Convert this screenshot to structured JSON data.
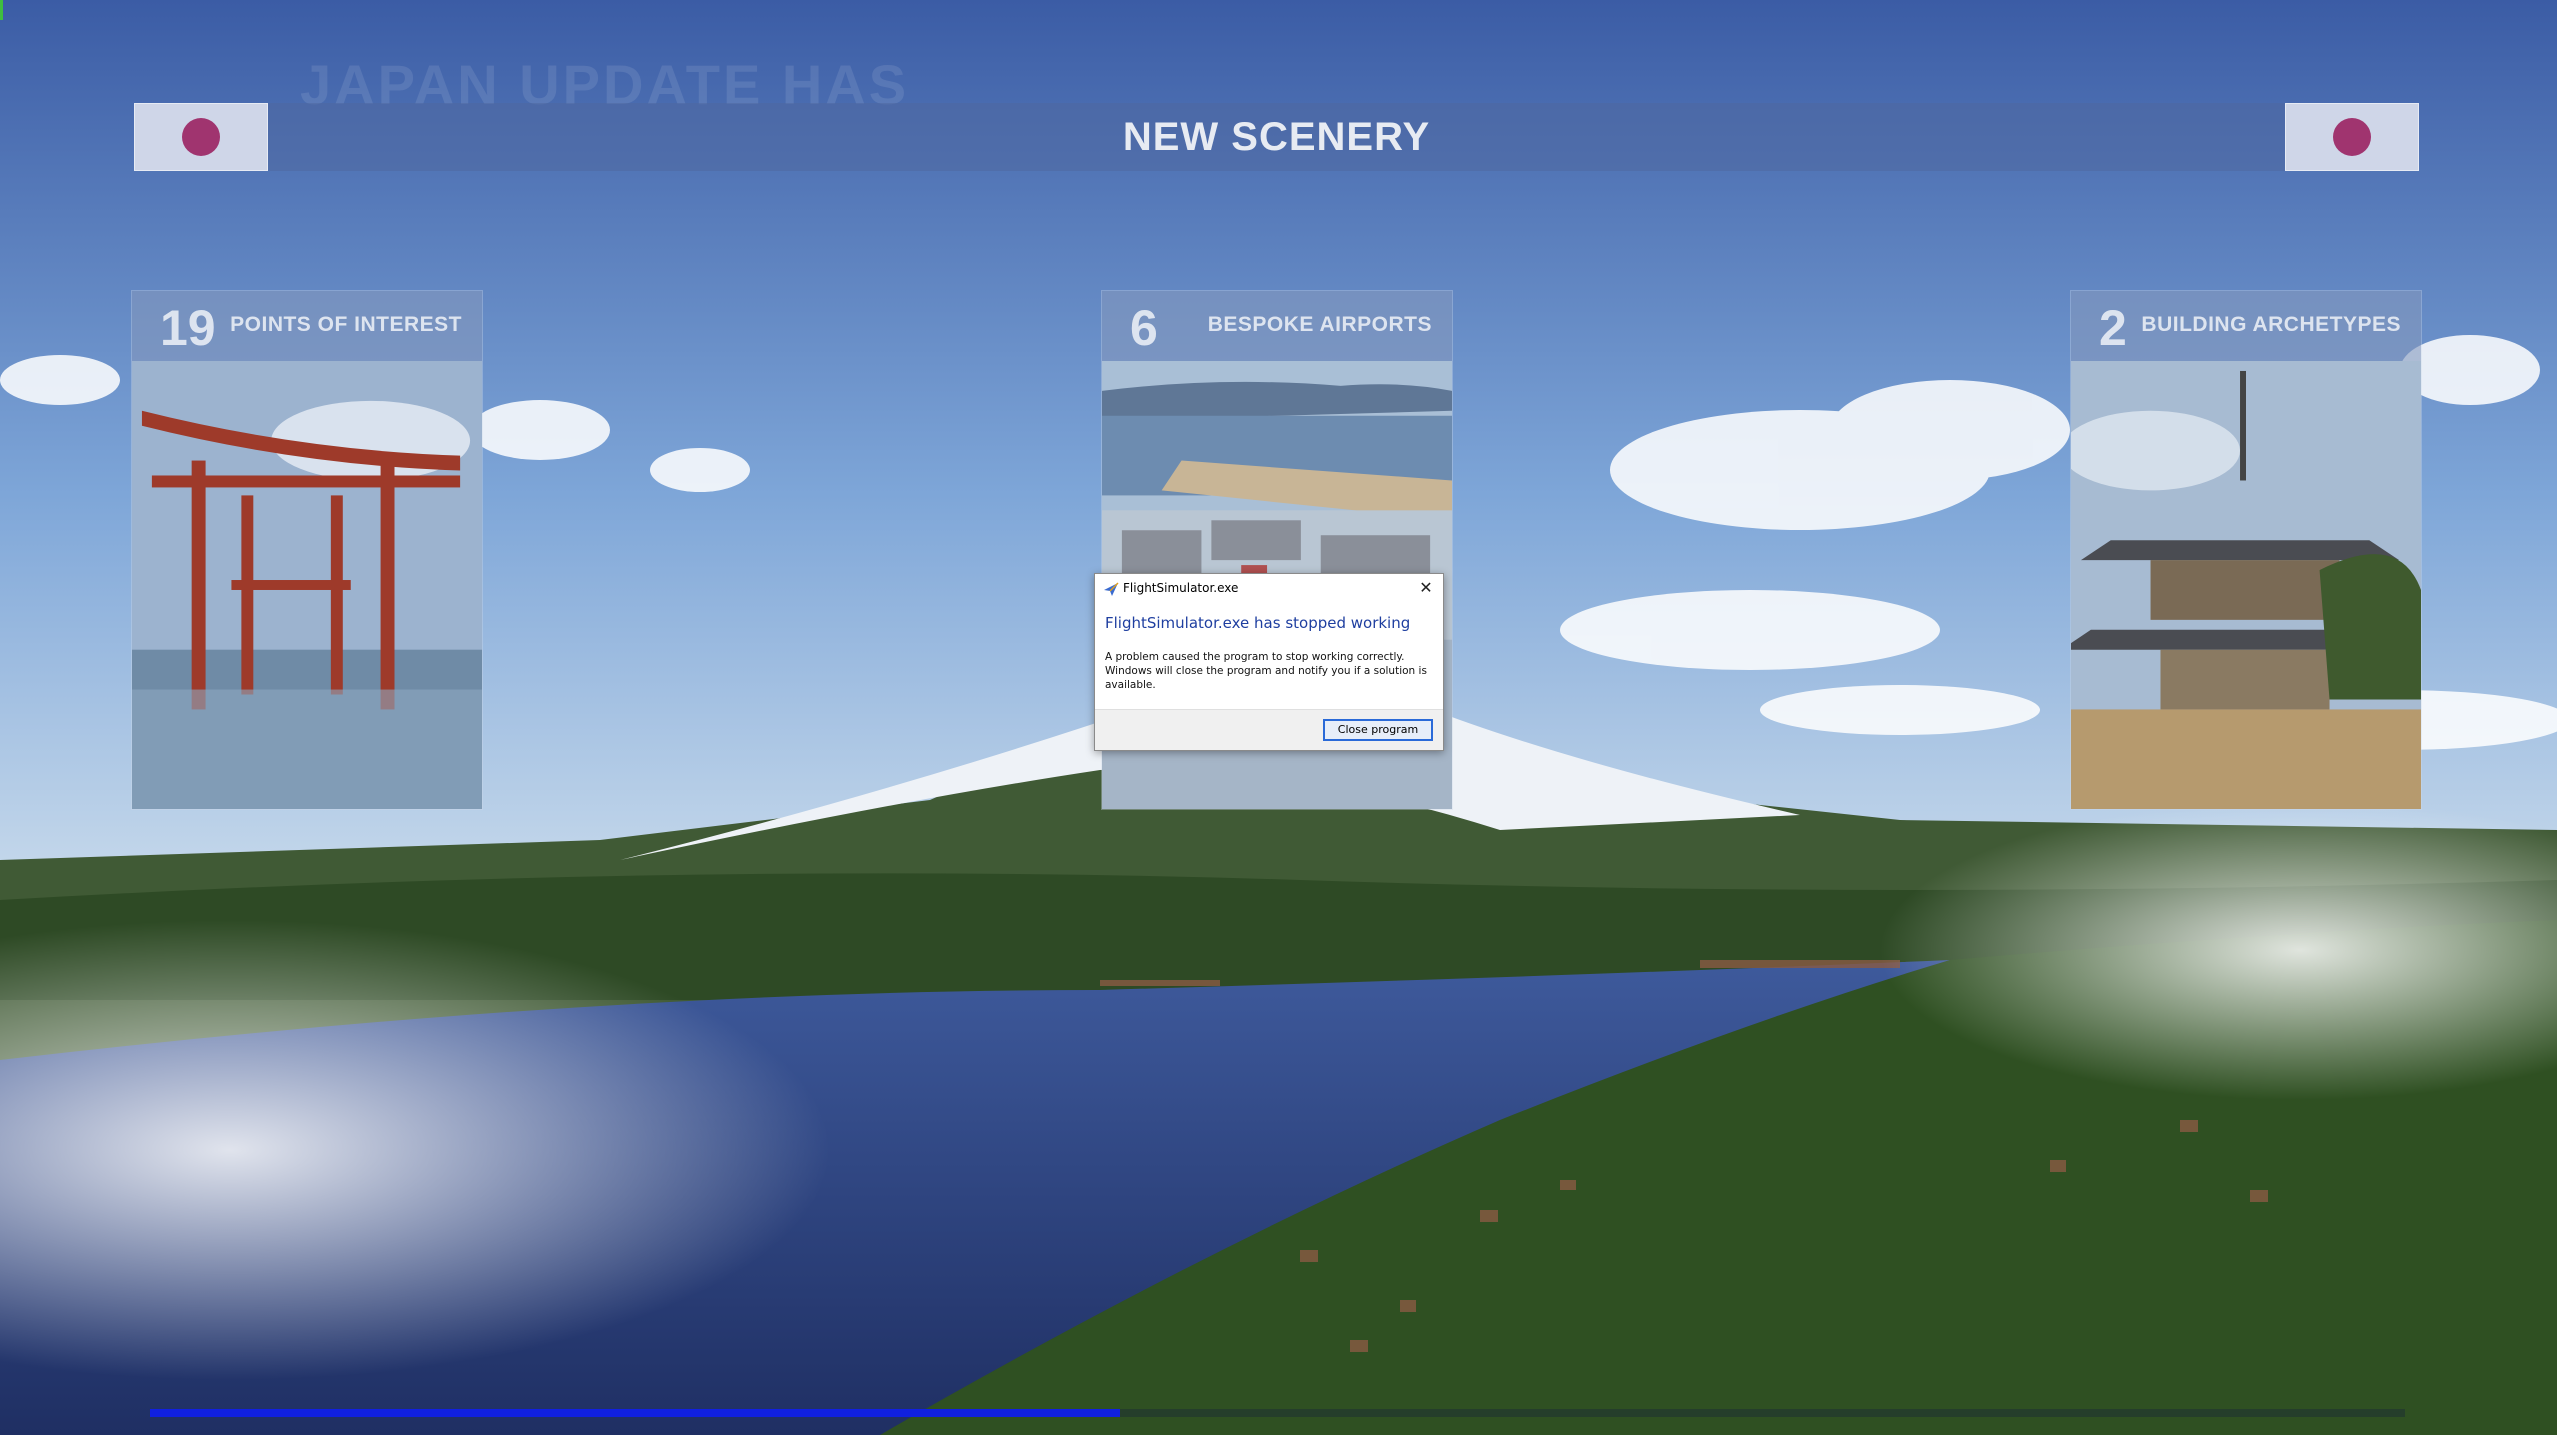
{
  "background": {
    "ghost_text": "JAPAN UPDATE HAS"
  },
  "banner": {
    "title": "NEW SCENERY",
    "flag_color": "#a0346f"
  },
  "cards": [
    {
      "count": "19",
      "label": "POINTS OF INTEREST",
      "image": "torii-gate"
    },
    {
      "count": "6",
      "label": "BESPOKE AIRPORTS",
      "image": "airport"
    },
    {
      "count": "2",
      "label": "BUILDING ARCHETYPES",
      "image": "pagoda"
    }
  ],
  "dialog": {
    "window_title": "FlightSimulator.exe",
    "heading": "FlightSimulator.exe has stopped working",
    "message": "A problem caused the program to stop working correctly. Windows will close the program and notify you if a solution is available.",
    "close_button": "Close program",
    "close_icon": "✕"
  },
  "progress": {
    "fraction": 0.43,
    "color": "#1020e0"
  }
}
